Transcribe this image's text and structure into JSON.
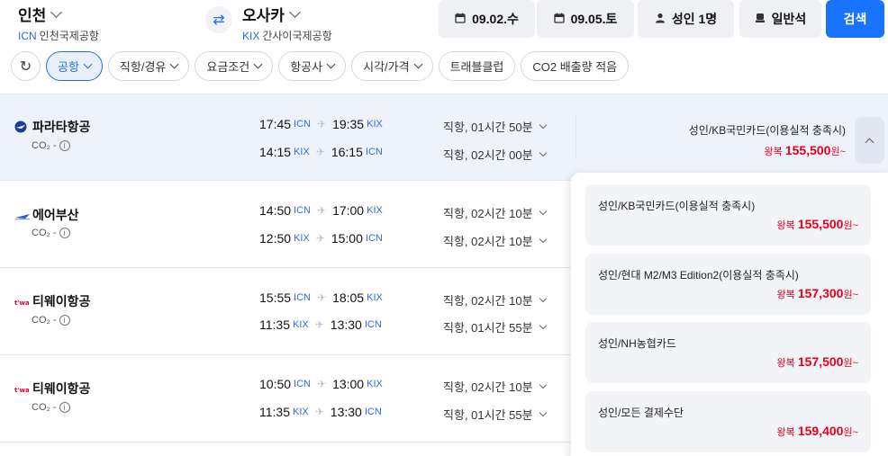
{
  "search": {
    "origin": {
      "city": "인천",
      "code": "ICN",
      "airport": "인천국제공항"
    },
    "destination": {
      "city": "오사카",
      "code": "KIX",
      "airport": "간사이국제공항"
    },
    "depart_date": "09.02.수",
    "return_date": "09.05.토",
    "passengers": "성인 1명",
    "cabin": "일반석",
    "search_label": "검색"
  },
  "filters": [
    {
      "label": "공항",
      "active": true,
      "has_dropdown": true
    },
    {
      "label": "직항/경유",
      "active": false,
      "has_dropdown": true
    },
    {
      "label": "요금조건",
      "active": false,
      "has_dropdown": true
    },
    {
      "label": "항공사",
      "active": false,
      "has_dropdown": true
    },
    {
      "label": "시각/가격",
      "active": false,
      "has_dropdown": true
    },
    {
      "label": "트래블클럽",
      "active": false,
      "has_dropdown": false
    },
    {
      "label": "CO2 배출량 적음",
      "active": false,
      "has_dropdown": false
    }
  ],
  "flights": [
    {
      "airline": "파라타항공",
      "co2": "CO₂ -",
      "outbound": {
        "dep": "17:45",
        "dep_code": "ICN",
        "arr": "19:35",
        "arr_code": "KIX",
        "duration": "직항, 01시간 50분"
      },
      "inbound": {
        "dep": "14:15",
        "dep_code": "KIX",
        "arr": "16:15",
        "arr_code": "ICN",
        "duration": "직항, 02시간 00분"
      },
      "price_label": "성인/KB국민카드(이용실적 충족시)",
      "price_prefix": "왕복",
      "price": "155,500",
      "price_suffix": "원~"
    },
    {
      "airline": "에어부산",
      "co2": "CO₂ -",
      "outbound": {
        "dep": "14:50",
        "dep_code": "ICN",
        "arr": "17:00",
        "arr_code": "KIX",
        "duration": "직항, 02시간 10분"
      },
      "inbound": {
        "dep": "12:50",
        "dep_code": "KIX",
        "arr": "15:00",
        "arr_code": "ICN",
        "duration": "직항, 02시간 10분"
      }
    },
    {
      "airline": "티웨이항공",
      "co2": "CO₂ -",
      "outbound": {
        "dep": "15:55",
        "dep_code": "ICN",
        "arr": "18:05",
        "arr_code": "KIX",
        "duration": "직항, 02시간 10분"
      },
      "inbound": {
        "dep": "11:35",
        "dep_code": "KIX",
        "arr": "13:30",
        "arr_code": "ICN",
        "duration": "직항, 01시간 55분"
      }
    },
    {
      "airline": "티웨이항공",
      "co2": "CO₂ -",
      "outbound": {
        "dep": "10:50",
        "dep_code": "ICN",
        "arr": "13:00",
        "arr_code": "KIX",
        "duration": "직항, 02시간 10분"
      },
      "inbound": {
        "dep": "11:35",
        "dep_code": "KIX",
        "arr": "13:30",
        "arr_code": "ICN",
        "duration": "직항, 01시간 55분"
      }
    }
  ],
  "price_options": [
    {
      "label": "성인/KB국민카드(이용실적 충족시)",
      "prefix": "왕복",
      "price": "155,500",
      "suffix": "원~"
    },
    {
      "label": "성인/현대 M2/M3 Edition2(이용실적 충족시)",
      "prefix": "왕복",
      "price": "157,300",
      "suffix": "원~"
    },
    {
      "label": "성인/NH농협카드",
      "prefix": "왕복",
      "price": "157,500",
      "suffix": "원~"
    },
    {
      "label": "성인/모든 결제수단",
      "prefix": "왕복",
      "price": "159,400",
      "suffix": "원~"
    }
  ],
  "colors": {
    "accent": "#1a73ff",
    "link": "#2b6be6",
    "price": "#e5001b",
    "selected_row": "#eef3fb"
  }
}
